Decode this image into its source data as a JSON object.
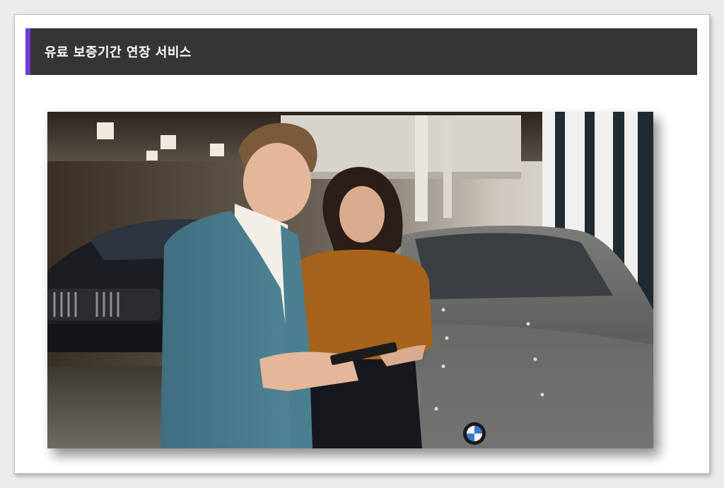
{
  "section": {
    "title": "유료 보증기간 연장 서비스"
  },
  "image": {
    "subject": "showroom-photo-icon"
  },
  "colors": {
    "title_bar_bg": "#353535",
    "title_accent": "#6f3bd9",
    "title_text": "#ffffff"
  }
}
